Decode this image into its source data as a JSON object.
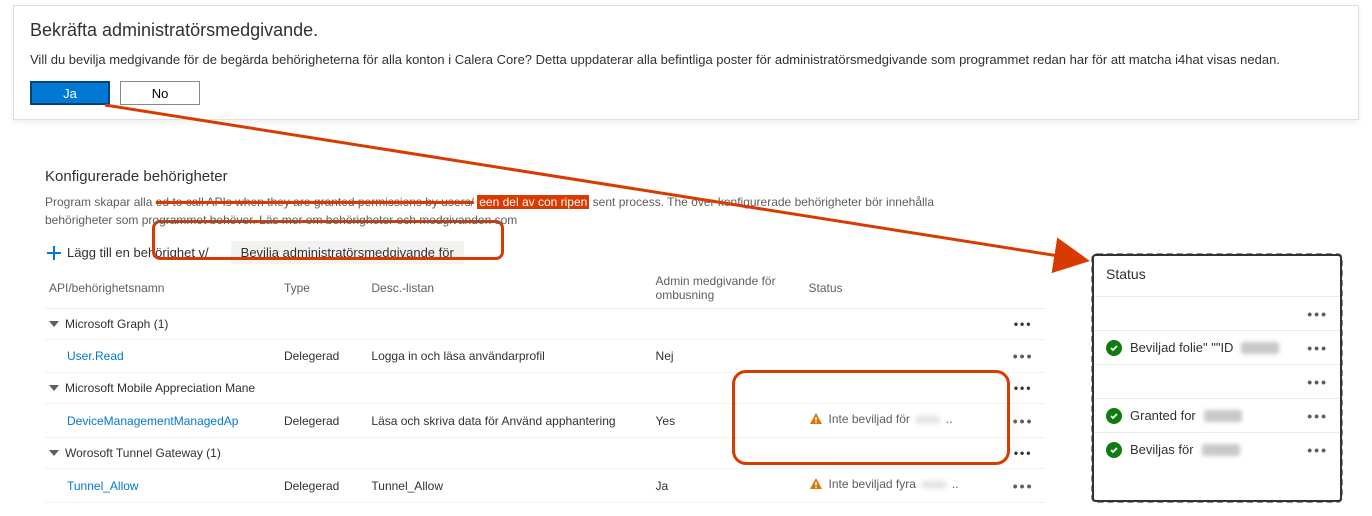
{
  "dialog": {
    "title": "Bekräfta administratörsmedgivande.",
    "body": "Vill du bevilja medgivande för de begärda behörigheterna för alla konton i Calera Core? Detta uppdaterar alla befintliga poster för administratörsmedgivande som programmet redan har för att matcha i4hat visas nedan.",
    "yes": "Ja",
    "no": "No"
  },
  "perm": {
    "heading": "Konfigurerade behörigheter",
    "line1a": "Program skapar alla",
    "line1b": "ed to call APIs when they are granted permissions by users/",
    "line1c": "een del av con ripen",
    "line1d": "sent process. The över konfigurerade behörigheter bör innehålla",
    "line2": "behörigheter som programmet behöver. Läs mer om behörigheter och medgivanden som",
    "addBtn": "Lägg till en behörighet v/",
    "grantBtn": "Bevilja administratörsmedgivande för"
  },
  "table": {
    "headers": {
      "api": "API/behörighetsnamn",
      "type": "Type",
      "desc": "Desc.-listan",
      "admin": "Admin medgivande för ombusning",
      "status": "Status"
    },
    "groups": [
      {
        "name": "Microsoft Graph (1)",
        "rows": [
          {
            "name": "User.Read",
            "type": "Delegerad",
            "desc": "Logga in och läsa användarprofil",
            "admin": "Nej",
            "status": "",
            "warn": false
          }
        ]
      },
      {
        "name": "Microsoft Mobile Appreciation Mane",
        "rows": [
          {
            "name": "DeviceManagementManagedAp",
            "type": "Delegerad",
            "desc": "Läsa och skriva data för Använd apphantering",
            "admin": "Yes",
            "status": "Inte beviljad för",
            "warn": true
          }
        ]
      },
      {
        "name": "Worosoft Tunnel Gateway (1)",
        "rows": [
          {
            "name": "Tunnel_Allow",
            "type": "Delegerad",
            "desc": "Tunnel_Allow",
            "admin": "Ja",
            "status": "Inte beviljad fyra",
            "warn": true
          }
        ]
      }
    ]
  },
  "panel": {
    "head": "Status",
    "rows": [
      {
        "ok": false,
        "text": ""
      },
      {
        "ok": true,
        "text": "Beviljad folie\" \"\"ID"
      },
      {
        "ok": false,
        "text": ""
      },
      {
        "ok": true,
        "text": "Granted for"
      },
      {
        "ok": true,
        "text": "Beviljas för"
      }
    ]
  }
}
